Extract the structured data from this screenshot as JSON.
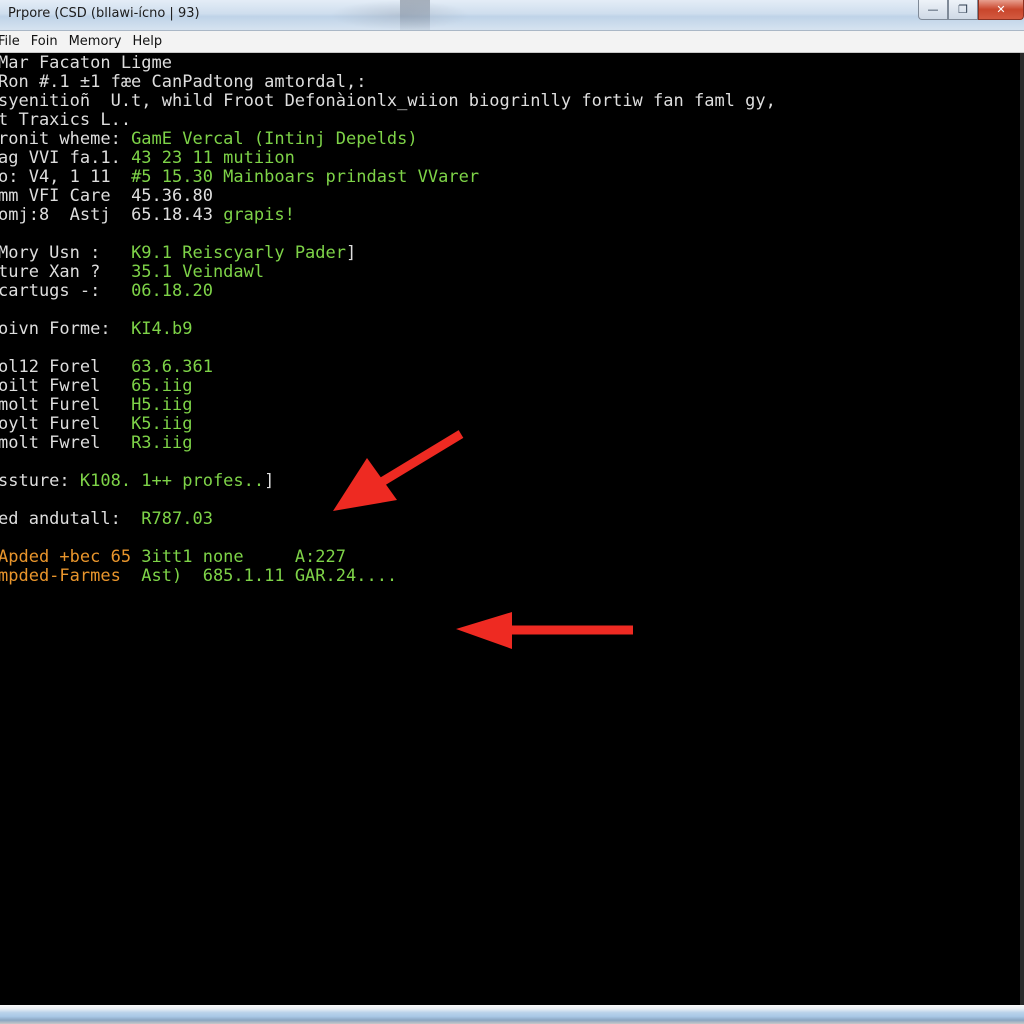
{
  "window": {
    "title": "Prpore (CSD (bllawi-ícno | 93)",
    "buttons": {
      "minimize": "—",
      "maximize": "❐",
      "close": "✕"
    }
  },
  "menu": [
    "File",
    "Foin",
    "Memory",
    "Help"
  ],
  "console": {
    "lines": [
      {
        "segments": [
          {
            "text": "Mar Facaton Ligme",
            "color": "white"
          }
        ]
      },
      {
        "segments": [
          {
            "text": "Ron #.1 ±1 fæe CanPadtong amtordal,:",
            "color": "white"
          }
        ]
      },
      {
        "segments": [
          {
            "text": "syenitioñ  U.t, whild Froot Defonàionlx_wiion biogrinlly fortiw fan faml gy,",
            "color": "white"
          }
        ]
      },
      {
        "segments": [
          {
            "text": "t Traxics L..",
            "color": "white"
          }
        ]
      },
      {
        "segments": [
          {
            "text": "ronit wheme: ",
            "color": "white"
          },
          {
            "text": "GamE Vercal (Intinj Depelds)",
            "color": "green"
          }
        ]
      },
      {
        "segments": [
          {
            "text": "ag VVI fa.1. ",
            "color": "white"
          },
          {
            "text": "43 23 11 mutiion",
            "color": "green"
          }
        ]
      },
      {
        "segments": [
          {
            "text": "o: V4, 1 11  ",
            "color": "white"
          },
          {
            "text": "#5 15.30 Mainboars prindast VVarer",
            "color": "green"
          }
        ]
      },
      {
        "segments": [
          {
            "text": "mm VFI Care  ",
            "color": "white"
          },
          {
            "text": "45.36.80",
            "color": "white"
          }
        ]
      },
      {
        "segments": [
          {
            "text": "omj:8  Astj  ",
            "color": "white"
          },
          {
            "text": "65.18.43 ",
            "color": "white"
          },
          {
            "text": "grapis!",
            "color": "green"
          }
        ]
      },
      {
        "segments": []
      },
      {
        "segments": [
          {
            "text": "Mory Usn :   ",
            "color": "white"
          },
          {
            "text": "K9.1 Reiscyarly Pader",
            "color": "green"
          },
          {
            "text": "]",
            "color": "white"
          }
        ]
      },
      {
        "segments": [
          {
            "text": "ture Xan ?   ",
            "color": "white"
          },
          {
            "text": "35.1 Veindawl",
            "color": "green"
          }
        ]
      },
      {
        "segments": [
          {
            "text": "cartugs -:   ",
            "color": "white"
          },
          {
            "text": "06.18.20",
            "color": "green"
          }
        ]
      },
      {
        "segments": []
      },
      {
        "segments": [
          {
            "text": "oivn Forme:  ",
            "color": "white"
          },
          {
            "text": "KI4.b9",
            "color": "green"
          }
        ]
      },
      {
        "segments": []
      },
      {
        "segments": [
          {
            "text": "ol12 Forel   ",
            "color": "white"
          },
          {
            "text": "63.6.361",
            "color": "green"
          }
        ]
      },
      {
        "segments": [
          {
            "text": "oilt Fwrel   ",
            "color": "white"
          },
          {
            "text": "65.iig",
            "color": "green"
          }
        ]
      },
      {
        "segments": [
          {
            "text": "molt Furel   ",
            "color": "white"
          },
          {
            "text": "H5.iig",
            "color": "green"
          }
        ]
      },
      {
        "segments": [
          {
            "text": "oylt Furel   ",
            "color": "white"
          },
          {
            "text": "K5.iig",
            "color": "green"
          }
        ]
      },
      {
        "segments": [
          {
            "text": "molt Fwrel   ",
            "color": "white"
          },
          {
            "text": "R3.iig",
            "color": "green"
          }
        ]
      },
      {
        "segments": []
      },
      {
        "segments": [
          {
            "text": "ssture: ",
            "color": "white"
          },
          {
            "text": "K108. 1++ profes..",
            "color": "green"
          },
          {
            "text": "]",
            "color": "white"
          }
        ]
      },
      {
        "segments": []
      },
      {
        "segments": [
          {
            "text": "ed andutall:  ",
            "color": "white"
          },
          {
            "text": "R787.03",
            "color": "green"
          }
        ]
      },
      {
        "segments": []
      },
      {
        "segments": [
          {
            "text": "Apded +bec 65 ",
            "color": "orange"
          },
          {
            "text": "3itt1 none     A:227",
            "color": "green"
          }
        ]
      },
      {
        "segments": [
          {
            "text": "mpded-Farmes  ",
            "color": "orange"
          },
          {
            "text": "Ast)  685.1.11 GAR.24....",
            "color": "green"
          }
        ]
      }
    ]
  },
  "annotations": [
    {
      "type": "arrow",
      "color": "#ee2a22",
      "direction": "down-left",
      "label": "red-arrow-diagonal"
    },
    {
      "type": "arrow",
      "color": "#ee2a22",
      "direction": "left",
      "label": "red-arrow-horizontal"
    }
  ],
  "colors": {
    "white": "#dedede",
    "green": "#7ed348",
    "orange": "#e8952c",
    "arrow": "#ee2a22",
    "console_bg": "#000000"
  }
}
